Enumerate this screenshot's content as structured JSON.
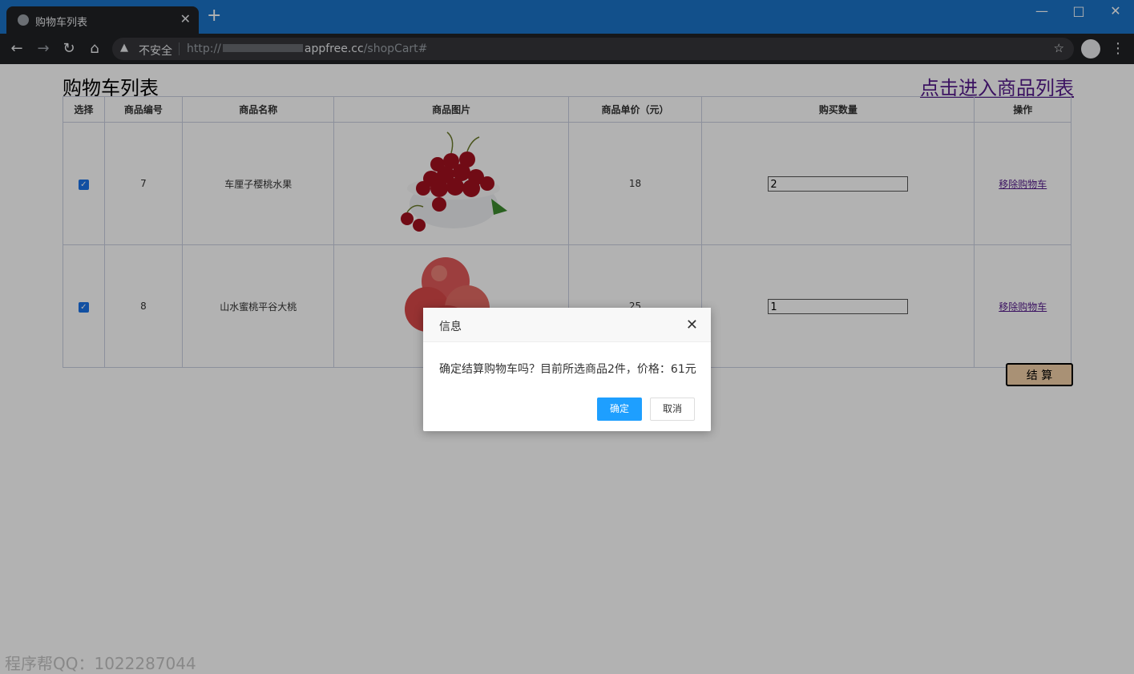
{
  "browser": {
    "tab_title": "购物车列表",
    "tab_close": "✕",
    "new_tab": "+",
    "insecure_label": "不安全",
    "url_prefix": "http://",
    "url_host": "appfree.cc",
    "url_path": "/shopCart#"
  },
  "page": {
    "title": "购物车列表",
    "goods_link": "点击进入商品列表",
    "checkout_label": "结 算"
  },
  "table": {
    "headers": [
      "选择",
      "商品编号",
      "商品名称",
      "商品图片",
      "商品单价（元）",
      "购买数量",
      "操作"
    ],
    "rows": [
      {
        "checked": true,
        "id": "7",
        "name": "车厘子樱桃水果",
        "image": "cherry",
        "price": "18",
        "qty": "2",
        "action": "移除购物车"
      },
      {
        "checked": true,
        "id": "8",
        "name": "山水蜜桃平谷大桃",
        "image": "peach",
        "price": "25",
        "qty": "1",
        "action": "移除购物车"
      }
    ]
  },
  "dialog": {
    "title": "信息",
    "message": "确定结算购物车吗？目前所选商品2件，价格：61元",
    "ok_label": "确定",
    "cancel_label": "取消"
  },
  "watermark": "程序帮QQ：1022287044",
  "colors": {
    "titlebar": "#1a73c8",
    "ok_button": "#1e9fff",
    "checkout_bg": "#f3d0a8",
    "link": "#551a8b"
  }
}
